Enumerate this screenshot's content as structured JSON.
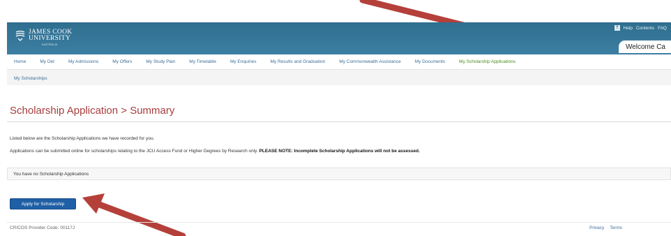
{
  "header": {
    "logo_line1": "JAMES COOK",
    "logo_line2": "UNIVERSITY",
    "logo_sub": "AUSTRALIA",
    "utility_links": [
      "Help",
      "Contents",
      "FAQ"
    ],
    "welcome_text": "Welcome Ca"
  },
  "nav": {
    "items": [
      {
        "label": "Home"
      },
      {
        "label": "My Det"
      },
      {
        "label": "My Admissions"
      },
      {
        "label": "My Offers"
      },
      {
        "label": "My Study Plan"
      },
      {
        "label": "My Timetable"
      },
      {
        "label": "My Enquiries"
      },
      {
        "label": "My Results and Graduation"
      },
      {
        "label": "My Commonwealth Assistance"
      },
      {
        "label": "My Documents"
      },
      {
        "label": "My Scholarship Applications"
      }
    ]
  },
  "subnav": {
    "label": "My Scholarships"
  },
  "page": {
    "title": "Scholarship Application > Summary",
    "intro": "Listed below are the Scholarship Applications we have recorded for you.",
    "note_prefix": "Applications can be submitted online for scholarships relating to the JCU Access Fund or Higher Degrees by Research only.",
    "note_bold": "PLEASE NOTE: Incomplete Scholarship Applications will not be assessed.",
    "empty_message": "You have no Scholarship Applications",
    "apply_button": "Apply for Scholarship"
  },
  "footer": {
    "provider_code": "CRICOS Provider Code: 00117J",
    "links": [
      "Privacy",
      "Terms"
    ]
  },
  "colors": {
    "header_blue": "#3c7fa2",
    "title_red": "#a83c3c",
    "button_blue": "#1f5fa6",
    "annotation_arrow": "#b5403a"
  }
}
